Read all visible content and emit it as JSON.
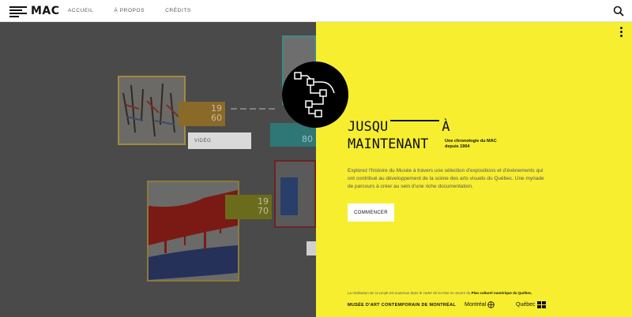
{
  "header": {
    "logo_text": "MAC",
    "nav": [
      "ACCUEIL",
      "À PROPOS",
      "CRÉDITS"
    ]
  },
  "timeline": {
    "years": [
      {
        "top": "19",
        "bottom": "60",
        "color": "#c28a1e"
      },
      {
        "top": "19",
        "bottom": "80",
        "color": "#3fa7a6"
      },
      {
        "top": "19",
        "bottom": "70",
        "color": "#9a9a30"
      }
    ],
    "video_label": "VIDÉO",
    "thumb_colors": {
      "thumb1": "#c9a24a",
      "thumb2": "#8b2a2a",
      "thumb3": "#b7963a"
    }
  },
  "hero": {
    "title_line1_a": "JUSQU",
    "title_line1_b": "À",
    "title_line2": "MAINTENANT",
    "subtitle_line1": "Une chronologie du MAC",
    "subtitle_line2": "depuis 1964",
    "description": "Explorez l'histoire du Musée à travers une sélection d'expositions et d'évènements qui ont contribué au développement de la scène des arts visuels du Québec. Une myriade de parcours à créer au sein d'une riche documentation.",
    "start_label": "COMMENCER",
    "accent": "#f7ee30"
  },
  "footer": {
    "credit_prefix": "La réalisation de ce projet est soutenue dans le cadre de la mise en œuvre du",
    "credit_link": "Plan culturel numérique du Québec.",
    "museum": "MUSÉE D'ART CONTEMPORAIN DE MONTRÉAL",
    "montreal": "Montréal",
    "quebec": "Québec"
  }
}
